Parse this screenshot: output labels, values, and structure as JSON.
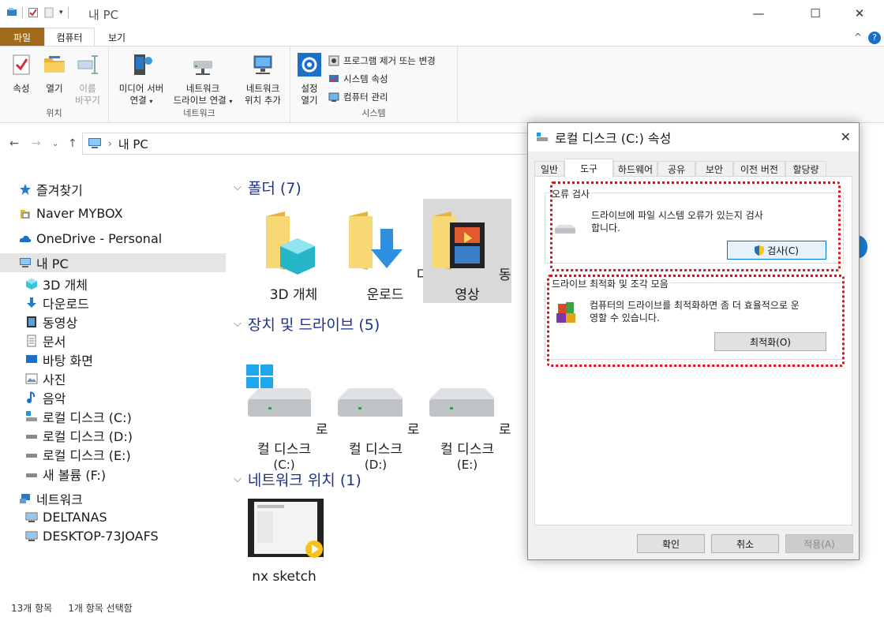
{
  "window": {
    "title": "내 PC"
  },
  "ribbon": {
    "tabs": {
      "file": "파일",
      "computer": "컴퓨터",
      "view": "보기"
    },
    "location_group": {
      "label": "위치",
      "properties": "속성",
      "open": "열기",
      "rename_1": "이름",
      "rename_2": "바꾸기"
    },
    "network_group": {
      "label": "네트워크",
      "media_1": "미디어 서버",
      "media_2": "연결",
      "map_1": "네트워크",
      "map_2": "드라이브 연결",
      "addloc_1": "네트워크",
      "addloc_2": "위치 추가"
    },
    "system_group": {
      "label": "시스템",
      "settings_1": "설정",
      "settings_2": "열기",
      "uninstall": "프로그램 제거 또는 변경",
      "sysprops": "시스템 속성",
      "manage": "컴퓨터 관리"
    }
  },
  "address": {
    "path": "내 PC"
  },
  "nav_pane": {
    "items": [
      {
        "label": "즐겨찾기",
        "icon": "star-icon"
      },
      {
        "label": "Naver MYBOX",
        "icon": "mybox-icon"
      },
      {
        "label": "OneDrive - Personal",
        "icon": "cloud-icon"
      },
      {
        "label": "내 PC",
        "icon": "pc-icon"
      },
      {
        "label": "3D 개체",
        "icon": "cube-icon"
      },
      {
        "label": "다운로드",
        "icon": "download-icon"
      },
      {
        "label": "동영상",
        "icon": "video-icon"
      },
      {
        "label": "문서",
        "icon": "document-icon"
      },
      {
        "label": "바탕 화면",
        "icon": "desktop-icon"
      },
      {
        "label": "사진",
        "icon": "picture-icon"
      },
      {
        "label": "음악",
        "icon": "music-icon"
      },
      {
        "label": "로컬 디스크 (C:)",
        "icon": "drive-c-icon"
      },
      {
        "label": "로컬 디스크 (D:)",
        "icon": "drive-icon"
      },
      {
        "label": "로컬 디스크 (E:)",
        "icon": "drive-icon"
      },
      {
        "label": "새 볼륨 (F:)",
        "icon": "drive-icon"
      },
      {
        "label": "네트워크",
        "icon": "network-icon"
      },
      {
        "label": "DELTANAS",
        "icon": "computer-icon"
      },
      {
        "label": "DESKTOP-73JOAFS",
        "icon": "computer-icon"
      }
    ]
  },
  "content": {
    "folders_header": "폴더 (7)",
    "folders": [
      "3D 개체",
      "다운로드",
      "동영상"
    ],
    "devices_header": "장치 및 드라이브 (5)",
    "drives": [
      {
        "name": "로컬 디스크",
        "letter": "(C:)"
      },
      {
        "name": "로컬 디스크",
        "letter": "(D:)"
      },
      {
        "name": "로컬 디스크",
        "letter": "(E:)"
      }
    ],
    "network_header": "네트워크 위치 (1)",
    "network_items": [
      "nx sketch"
    ]
  },
  "status": {
    "count": "13개 항목",
    "selected": "1개 항목 선택함"
  },
  "dialog": {
    "title": "로컬 디스크 (C:) 속성",
    "tabs": [
      "일반",
      "도구",
      "하드웨어",
      "공유",
      "보안",
      "이전 버전",
      "할당량"
    ],
    "active_tab": "도구",
    "error_check": {
      "title": "오류 검사",
      "text_1": "드라이브에 파일 시스템 오류가 있는지 검사",
      "text_2": "합니다.",
      "button": "검사(C)"
    },
    "optimize": {
      "title": "드라이브 최적화 및 조각 모음",
      "text_1": "컴퓨터의 드라이브를 최적화하면 좀 더 효율적으로 운",
      "text_2": "영할 수 있습니다.",
      "button": "최적화(O)"
    },
    "buttons": {
      "ok": "확인",
      "cancel": "취소",
      "apply": "적용(A)"
    }
  },
  "colors": {
    "accent": "#0078d7",
    "file_tab": "#a06a1a",
    "highlight_red": "#e0101a",
    "section_title": "#1e3287"
  }
}
